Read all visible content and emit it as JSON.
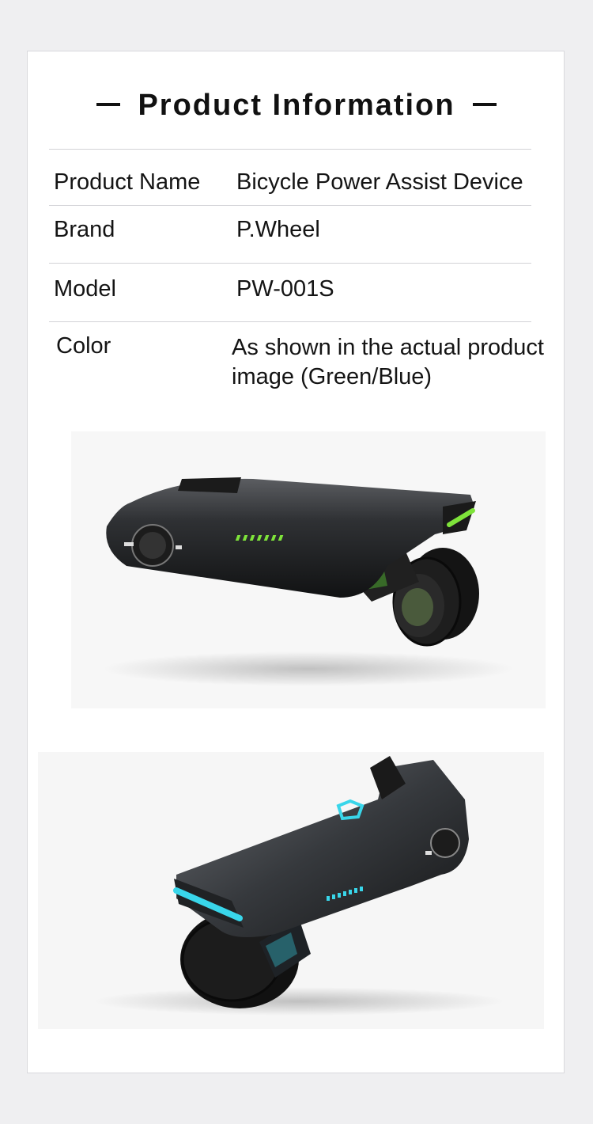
{
  "section_title": "Product Information",
  "specs": [
    {
      "label": "Product Name",
      "value": "Bicycle Power Assist Device"
    },
    {
      "label": "Brand",
      "value": "P.Wheel"
    },
    {
      "label": "Model",
      "value": "PW-001S"
    },
    {
      "label": "Color",
      "value": "As shown in the actual product image (Green/Blue)"
    }
  ],
  "images": [
    {
      "accent": "#7ee33a",
      "device": "bicycle-power-assist-device-green"
    },
    {
      "accent": "#39d6ea",
      "device": "bicycle-power-assist-device-blue"
    }
  ]
}
